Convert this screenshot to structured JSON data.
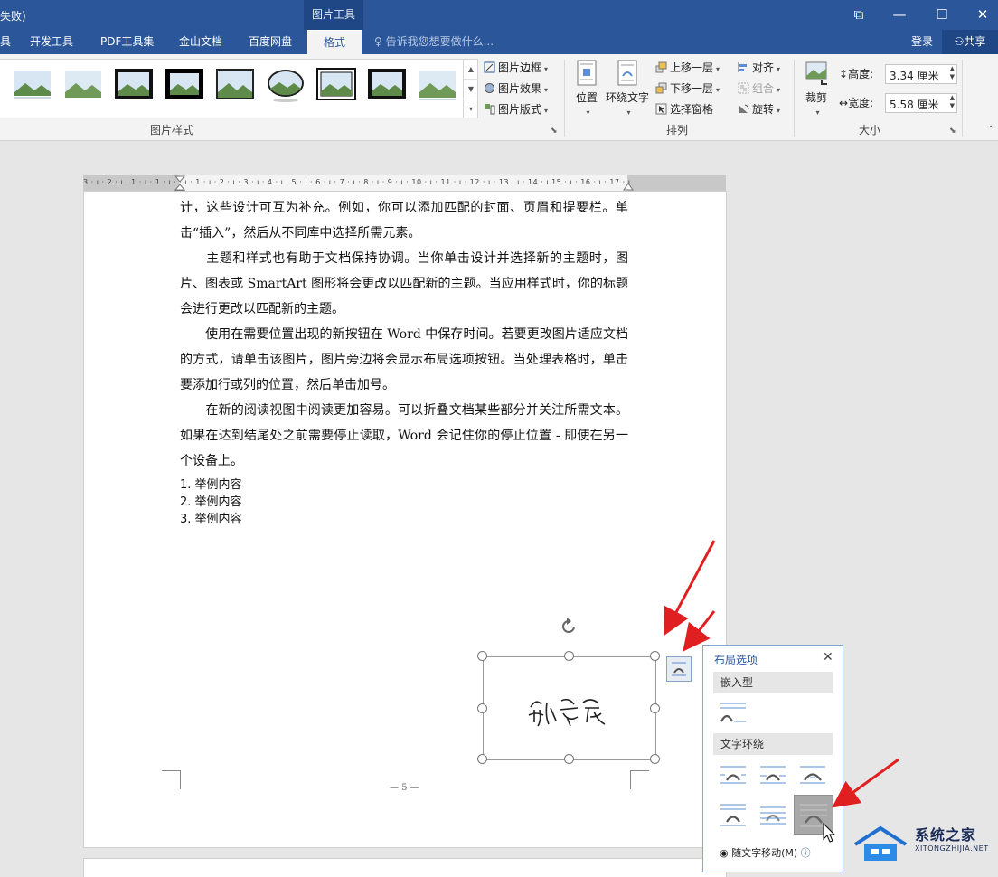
{
  "window": {
    "title_fragment": "失败)",
    "context_tab_title": "图片工具",
    "controls": [
      "⧉",
      "—",
      "☐",
      "✕"
    ]
  },
  "tabs": {
    "items": [
      "具",
      "开发工具",
      "PDF工具集",
      "金山文档",
      "百度网盘",
      "格式"
    ],
    "active": "格式",
    "tell_me_placeholder": "告诉我您想要做什么...",
    "login": "登录",
    "share": "共享"
  },
  "ribbon": {
    "picture_styles_label": "图片样式",
    "picture_border": "图片边框",
    "picture_effects": "图片效果",
    "picture_layout": "图片版式",
    "position": "位置",
    "wrap_text": "环绕文字",
    "bring_forward": "上移一层",
    "send_backward": "下移一层",
    "selection_pane": "选择窗格",
    "align": "对齐",
    "group": "组合",
    "rotate": "旋转",
    "arrange_label": "排列",
    "crop": "裁剪",
    "height_label": "高度:",
    "height_value": "3.34 厘米",
    "width_label": "宽度:",
    "width_value": "5.58 厘米",
    "size_label": "大小"
  },
  "ruler": {
    "marks": "3 · ı · 2 · ı · 1 · ı · 1 · ı ·   · ı · 1 · ı · 2 · ı · 3 · ı · 4 · ı · 5 · ı · 6 · ı · 7 · ı · 8 · ı · 9 · ı · 10 · ı · 11 · ı · 12 · ı · 13 · ı · 14 · ı   15 · ı · 16 · ı · 17 · ı"
  },
  "document": {
    "paragraphs": [
      "计，这些设计可互为补充。例如，你可以添加匹配的封面、页眉和提要栏。单击“插入”，然后从不同库中选择所需元素。",
      "　　主题和样式也有助于文档保持协调。当你单击设计并选择新的主题时，图片、图表或 SmartArt 图形将会更改以匹配新的主题。当应用样式时，你的标题会进行更改以匹配新的主题。",
      "　　使用在需要位置出现的新按钮在 Word 中保存时间。若要更改图片适应文档的方式，请单击该图片，图片旁边将会显示布局选项按钮。当处理表格时，单击要添加行或列的位置，然后单击加号。",
      "　　在新的阅读视图中阅读更加容易。可以折叠文档某些部分并关注所需文本。如果在达到结尾处之前需要停止读取，Word 会记住你的停止位置 - 即使在另一个设备上。"
    ],
    "list": [
      "1. 举例内容",
      "2. 举例内容",
      "3. 举例内容"
    ],
    "page_number": "— 5 —",
    "signature": "郝兪宾"
  },
  "layout_panel": {
    "title": "布局选项",
    "close": "✕",
    "inline_section": "嵌入型",
    "wrap_section": "文字环绕",
    "move_with_text": "随文字移动(M)"
  },
  "watermark": {
    "name": "系统之家",
    "url": "XITONGZHIJIA.NET"
  },
  "colors": {
    "accent": "#2b579a",
    "arrow": "#e02020"
  }
}
